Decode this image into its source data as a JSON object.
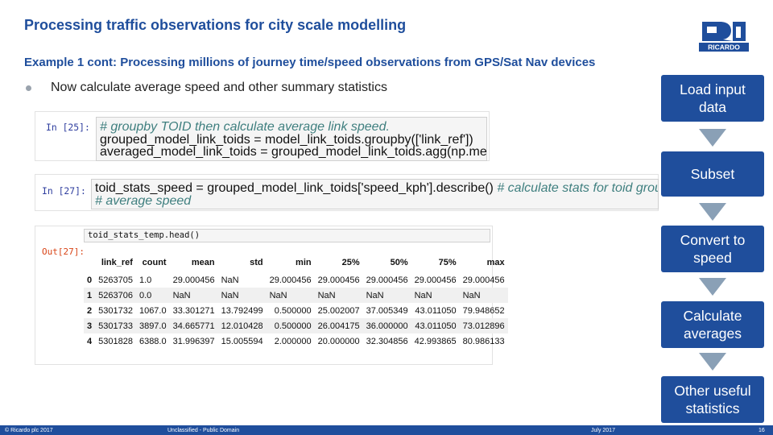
{
  "slide": {
    "title": "Processing traffic observations for city scale modelling",
    "subtitle": "Example 1 cont: Processing millions of journey time/speed observations from GPS/Sat Nav devices",
    "bullet": "Now calculate average speed and other summary statistics"
  },
  "logo": {
    "text": "RICARDO",
    "brand_color": "#1f4e9c"
  },
  "cell1": {
    "prompt": "In [25]:",
    "lines": [
      "# groupby TOID then calculate average link speed.",
      "grouped_model_link_toids = model_link_toids.groupby(['link_ref'])",
      "averaged_model_link_toids = grouped_model_link_toids.agg(np.mean)"
    ]
  },
  "cell2": {
    "prompt": "In [27]:",
    "line1_code": "toid_stats_speed = grouped_model_link_toids['speed_kph'].describe()",
    "line1_comment": " # calculate stats for toid group",
    "line2": "# average speed"
  },
  "cell3": {
    "code": "toid_stats_temp.head()",
    "out_prompt": "Out[27]:",
    "columns": [
      "",
      "link_ref",
      "count",
      "mean",
      "std",
      "min",
      "25%",
      "50%",
      "75%",
      "max"
    ],
    "rows": [
      [
        "0",
        "5263705",
        "1.0",
        "29.000456",
        "NaN",
        "29.000456",
        "29.000456",
        "29.000456",
        "29.000456",
        "29.000456"
      ],
      [
        "1",
        "5263706",
        "0.0",
        "NaN",
        "NaN",
        "NaN",
        "NaN",
        "NaN",
        "NaN",
        "NaN"
      ],
      [
        "2",
        "5301732",
        "1067.0",
        "33.301271",
        "13.792499",
        "0.500000",
        "25.002007",
        "37.005349",
        "43.011050",
        "79.948652"
      ],
      [
        "3",
        "5301733",
        "3897.0",
        "34.665771",
        "12.010428",
        "0.500000",
        "26.004175",
        "36.000000",
        "43.011050",
        "73.012896"
      ],
      [
        "4",
        "5301828",
        "6388.0",
        "31.996397",
        "15.005594",
        "2.000000",
        "20.000000",
        "32.304856",
        "42.993865",
        "80.986133"
      ]
    ]
  },
  "flow": {
    "steps": [
      "Load input data",
      "Subset",
      "Convert to speed",
      "Calculate averages",
      "Other useful statistics"
    ]
  },
  "footer": {
    "copyright": "© Ricardo plc 2017",
    "classification": "Unclassified - Public Domain",
    "date": "July 2017",
    "page": "16"
  }
}
